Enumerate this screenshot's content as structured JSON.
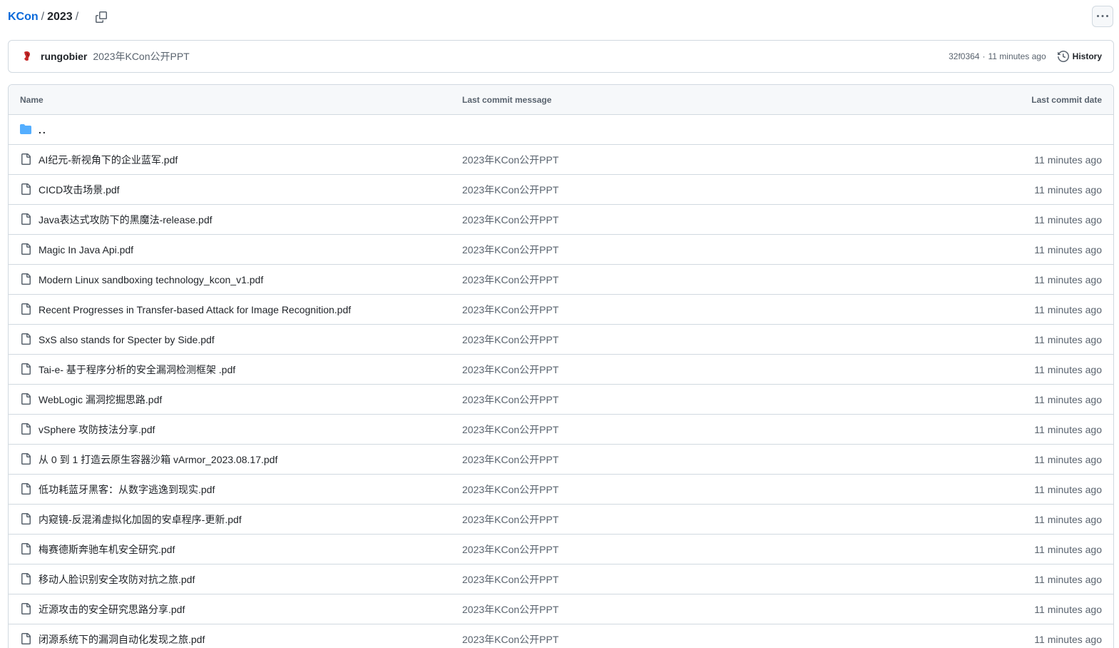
{
  "breadcrumb": {
    "repo": "KCon",
    "separator": "/",
    "current": "2023",
    "trailing": "/"
  },
  "latest_commit": {
    "author": "rungobier",
    "message": "2023年KCon公开PPT",
    "sha": "32f0364",
    "dot": "·",
    "time": "11 minutes ago",
    "history_label": "History"
  },
  "table": {
    "headers": {
      "name": "Name",
      "message": "Last commit message",
      "date": "Last commit date"
    },
    "parent_dir": "..",
    "files": [
      {
        "name": "AI纪元-新视角下的企业蓝军.pdf",
        "message": "2023年KCon公开PPT",
        "date": "11 minutes ago"
      },
      {
        "name": "CICD攻击场景.pdf",
        "message": "2023年KCon公开PPT",
        "date": "11 minutes ago"
      },
      {
        "name": "Java表达式攻防下的黑魔法-release.pdf",
        "message": "2023年KCon公开PPT",
        "date": "11 minutes ago"
      },
      {
        "name": "Magic In Java Api.pdf",
        "message": "2023年KCon公开PPT",
        "date": "11 minutes ago"
      },
      {
        "name": "Modern Linux sandboxing technology_kcon_v1.pdf",
        "message": "2023年KCon公开PPT",
        "date": "11 minutes ago"
      },
      {
        "name": "Recent Progresses in Transfer-based Attack for Image Recognition.pdf",
        "message": "2023年KCon公开PPT",
        "date": "11 minutes ago"
      },
      {
        "name": "SxS also stands for Specter by Side.pdf",
        "message": "2023年KCon公开PPT",
        "date": "11 minutes ago"
      },
      {
        "name": "Tai-e- 基于程序分析的安全漏洞检测框架 .pdf",
        "message": "2023年KCon公开PPT",
        "date": "11 minutes ago"
      },
      {
        "name": "WebLogic 漏洞挖掘思路.pdf",
        "message": "2023年KCon公开PPT",
        "date": "11 minutes ago"
      },
      {
        "name": "vSphere 攻防技法分享.pdf",
        "message": "2023年KCon公开PPT",
        "date": "11 minutes ago"
      },
      {
        "name": "从 0 到 1 打造云原生容器沙箱 vArmor_2023.08.17.pdf",
        "message": "2023年KCon公开PPT",
        "date": "11 minutes ago"
      },
      {
        "name": "低功耗蓝牙黑客：从数字逃逸到现实.pdf",
        "message": "2023年KCon公开PPT",
        "date": "11 minutes ago"
      },
      {
        "name": "内窥镜-反混淆虚拟化加固的安卓程序-更新.pdf",
        "message": "2023年KCon公开PPT",
        "date": "11 minutes ago"
      },
      {
        "name": "梅赛德斯奔驰车机安全研究.pdf",
        "message": "2023年KCon公开PPT",
        "date": "11 minutes ago"
      },
      {
        "name": "移动人脸识别安全攻防对抗之旅.pdf",
        "message": "2023年KCon公开PPT",
        "date": "11 minutes ago"
      },
      {
        "name": "近源攻击的安全研究思路分享.pdf",
        "message": "2023年KCon公开PPT",
        "date": "11 minutes ago"
      },
      {
        "name": "闭源系统下的漏洞自动化发现之旅.pdf",
        "message": "2023年KCon公开PPT",
        "date": "11 minutes ago"
      }
    ]
  },
  "icons": {
    "copy": "copy-icon",
    "more": "kebab-horizontal-icon",
    "history": "history-icon",
    "folder": "folder-icon",
    "file": "file-icon"
  },
  "colors": {
    "link": "#0969da",
    "folder": "#54aeff",
    "border": "#d1d9e0",
    "muted": "#59636e",
    "header_bg": "#f6f8fa"
  }
}
